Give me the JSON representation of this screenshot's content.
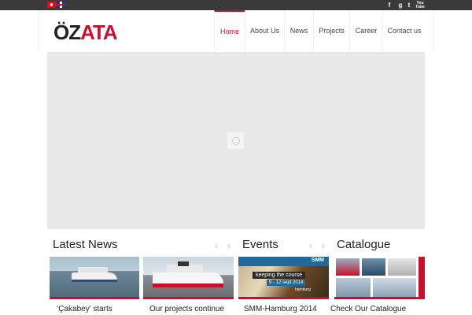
{
  "topbar": {
    "flags": [
      "turkish-flag",
      "english-flag"
    ],
    "social": [
      {
        "name": "facebook",
        "label": "f"
      },
      {
        "name": "google-plus",
        "label": "g"
      },
      {
        "name": "twitter",
        "label": "t"
      },
      {
        "name": "youtube",
        "label": "You Tube"
      }
    ]
  },
  "header": {
    "logo_prefix": "ÖZ",
    "logo_main": "ATA",
    "nav": [
      {
        "label": "Home",
        "active": true
      },
      {
        "label": "About Us"
      },
      {
        "label": "News"
      },
      {
        "label": "Projects"
      },
      {
        "label": "Career"
      },
      {
        "label": "Contact us"
      }
    ]
  },
  "sections": {
    "news": {
      "title": "Latest News",
      "prev_icon": "‹",
      "next_icon": "›",
      "items": [
        {
          "caption": "‘Çakabey’ starts"
        },
        {
          "caption": "Our projects continue"
        }
      ]
    },
    "events": {
      "title": "Events",
      "prev_icon": "‹",
      "next_icon": "›",
      "items": [
        {
          "caption": "SMM-Hamburg 2014",
          "banner": {
            "top": "SMM",
            "headline": "keeping the course",
            "dates": "9 - 12 sept 2014",
            "city": "hamburg"
          }
        }
      ]
    },
    "catalogue": {
      "title": "Catalogue",
      "items": [
        {
          "caption": "Check Our Catalogue"
        }
      ]
    }
  },
  "colors": {
    "accent": "#c8102e",
    "topbar": "#3a3a3a",
    "slider_bg": "#e8e8e8"
  }
}
